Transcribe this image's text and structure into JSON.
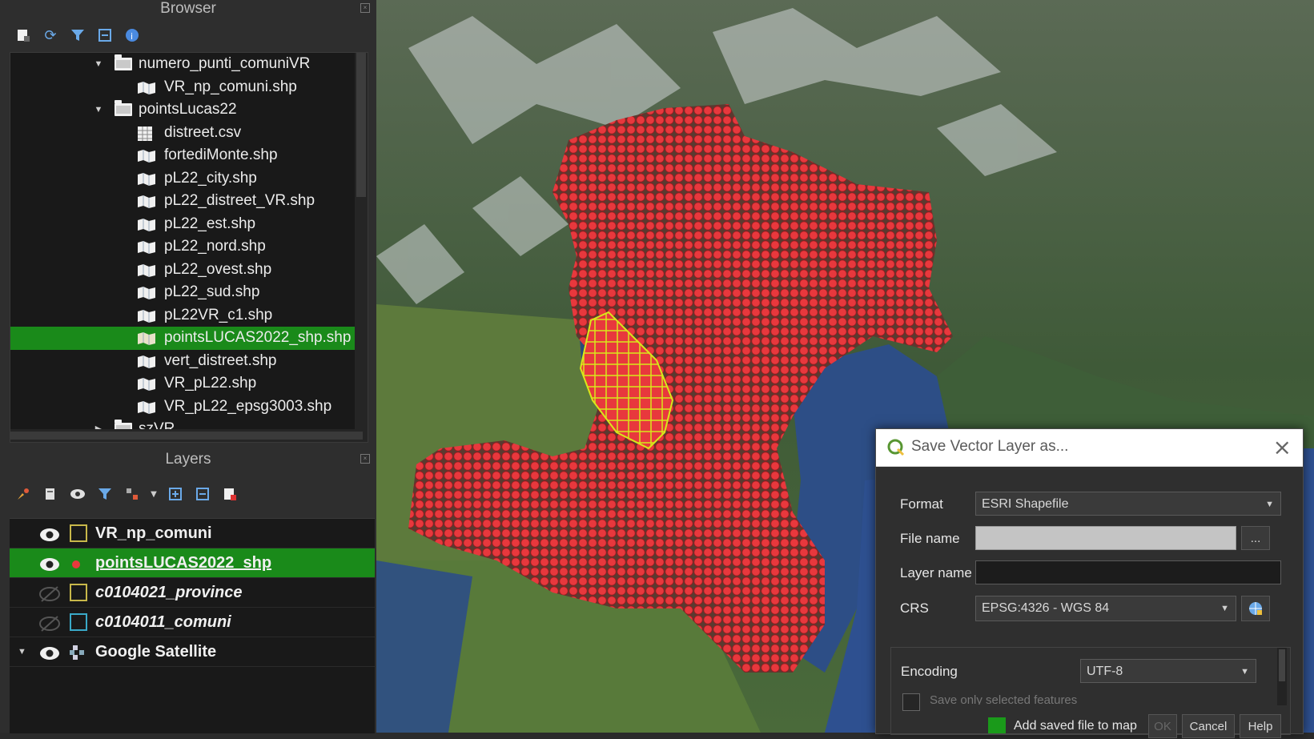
{
  "browser": {
    "title": "Browser",
    "items": [
      {
        "label": "numero_punti_comuniVR",
        "kind": "folder",
        "level": 1,
        "expanded": true
      },
      {
        "label": "VR_np_comuni.shp",
        "kind": "shape",
        "level": 2
      },
      {
        "label": "pointsLucas22",
        "kind": "folder",
        "level": 1,
        "expanded": true
      },
      {
        "label": "distreet.csv",
        "kind": "table",
        "level": 2
      },
      {
        "label": "fortediMonte.shp",
        "kind": "shape",
        "level": 2
      },
      {
        "label": "pL22_city.shp",
        "kind": "shape",
        "level": 2
      },
      {
        "label": "pL22_distreet_VR.shp",
        "kind": "shape",
        "level": 2
      },
      {
        "label": "pL22_est.shp",
        "kind": "shape",
        "level": 2
      },
      {
        "label": "pL22_nord.shp",
        "kind": "shape",
        "level": 2
      },
      {
        "label": "pL22_ovest.shp",
        "kind": "shape",
        "level": 2
      },
      {
        "label": "pL22_sud.shp",
        "kind": "shape",
        "level": 2
      },
      {
        "label": "pL22VR_c1.shp",
        "kind": "shape",
        "level": 2
      },
      {
        "label": "pointsLUCAS2022_shp.shp",
        "kind": "shape",
        "level": 2,
        "selected": true
      },
      {
        "label": "vert_distreet.shp",
        "kind": "shape",
        "level": 2
      },
      {
        "label": "VR_pL22.shp",
        "kind": "shape",
        "level": 2
      },
      {
        "label": "VR_pL22_epsg3003.shp",
        "kind": "shape",
        "level": 2
      },
      {
        "label": "szVR",
        "kind": "folder",
        "level": 1,
        "expanded": false
      }
    ]
  },
  "layers": {
    "title": "Layers",
    "items": [
      {
        "name": "VR_np_comuni",
        "visible": true,
        "symbol": "box-yellow",
        "italic": false
      },
      {
        "name": "pointsLUCAS2022_shp",
        "visible": true,
        "symbol": "dot-red",
        "italic": false,
        "selected": true
      },
      {
        "name": "c0104021_province",
        "visible": false,
        "symbol": "box-yellow",
        "italic": true
      },
      {
        "name": "c0104011_comuni",
        "visible": false,
        "symbol": "box-cyan",
        "italic": true
      },
      {
        "name": "Google Satellite",
        "visible": true,
        "symbol": "raster",
        "italic": false,
        "expandable": true
      }
    ]
  },
  "dialog": {
    "title": "Save Vector Layer as...",
    "format_label": "Format",
    "format_value": "ESRI Shapefile",
    "filename_label": "File name",
    "filename_value": "",
    "browse_label": "...",
    "layername_label": "Layer name",
    "layername_value": "",
    "crs_label": "CRS",
    "crs_value": "EPSG:4326 - WGS 84",
    "encoding_label": "Encoding",
    "encoding_value": "UTF-8",
    "save_selected_label": "Save only selected features",
    "add_to_map_label": "Add saved file to map",
    "ok_label": "OK",
    "cancel_label": "Cancel",
    "help_label": "Help"
  },
  "colors": {
    "selection": "#1a8a1a",
    "points": "#e8383d",
    "highlight": "#d8e81a"
  }
}
